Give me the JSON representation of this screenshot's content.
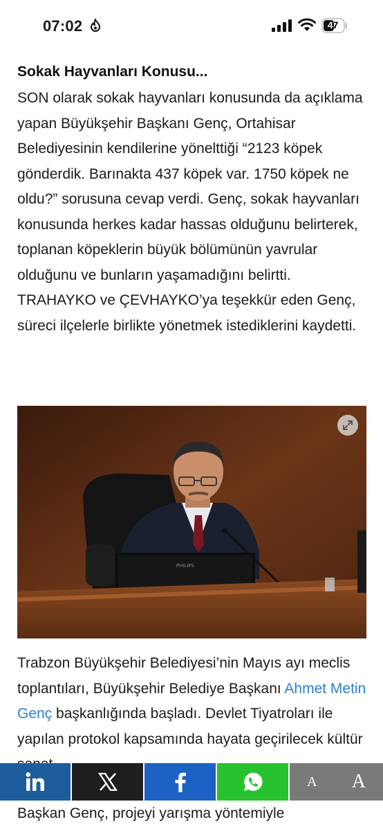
{
  "status_bar": {
    "time": "07:02",
    "battery_level": "47"
  },
  "article": {
    "section_heading": "Sokak Hayvanları Konusu...",
    "paragraph_1": "SON olarak sokak hayvanları konusunda da açıklama yapan Büyükşehir Başkanı Genç, Ortahisar Belediyesinin kendilerine yönelttiği “2123 köpek gönderdik. Barınakta 437 köpek var. 1750 köpek ne oldu?” sorusuna cevap verdi. Genç, sokak hayvanları konusunda herkes kadar hassas olduğunu belirterek, toplanan köpeklerin büyük bölümünün yavrular olduğunu  ve bunların yaşamadığını belirtti. TRAHAYKO ve ÇEVHAYKO’ya teşekkür eden Genç, süreci ilçelerle birlikte yönetmek istediklerini kaydetti.",
    "photo": {
      "monitor_brand": "PHILIPS"
    },
    "paragraph_2": {
      "part_1": "Trabzon Büyükşehir Belediyesi’nin Mayıs ayı meclis toplantıları, Büyükşehir Belediye Başkanı ",
      "link": "Ahmet Metin Genç",
      "part_2": " başkanlığında başladı. Devlet Tiyatroları ile yapılan protokol kapsamında hayata geçirilecek kültür sanat"
    },
    "paragraph_3": "Başkan Genç, projeyi yarışma yöntemiyle"
  },
  "share_bar": {
    "font_small_label": "A",
    "font_large_label": "A"
  },
  "colors": {
    "linkedin": "#1d5d9c",
    "x": "#1f1f1f",
    "facebook": "#1c62c4",
    "whatsapp": "#27c32e",
    "font_size": "#7a7a7a",
    "link": "#2b7fd0"
  }
}
